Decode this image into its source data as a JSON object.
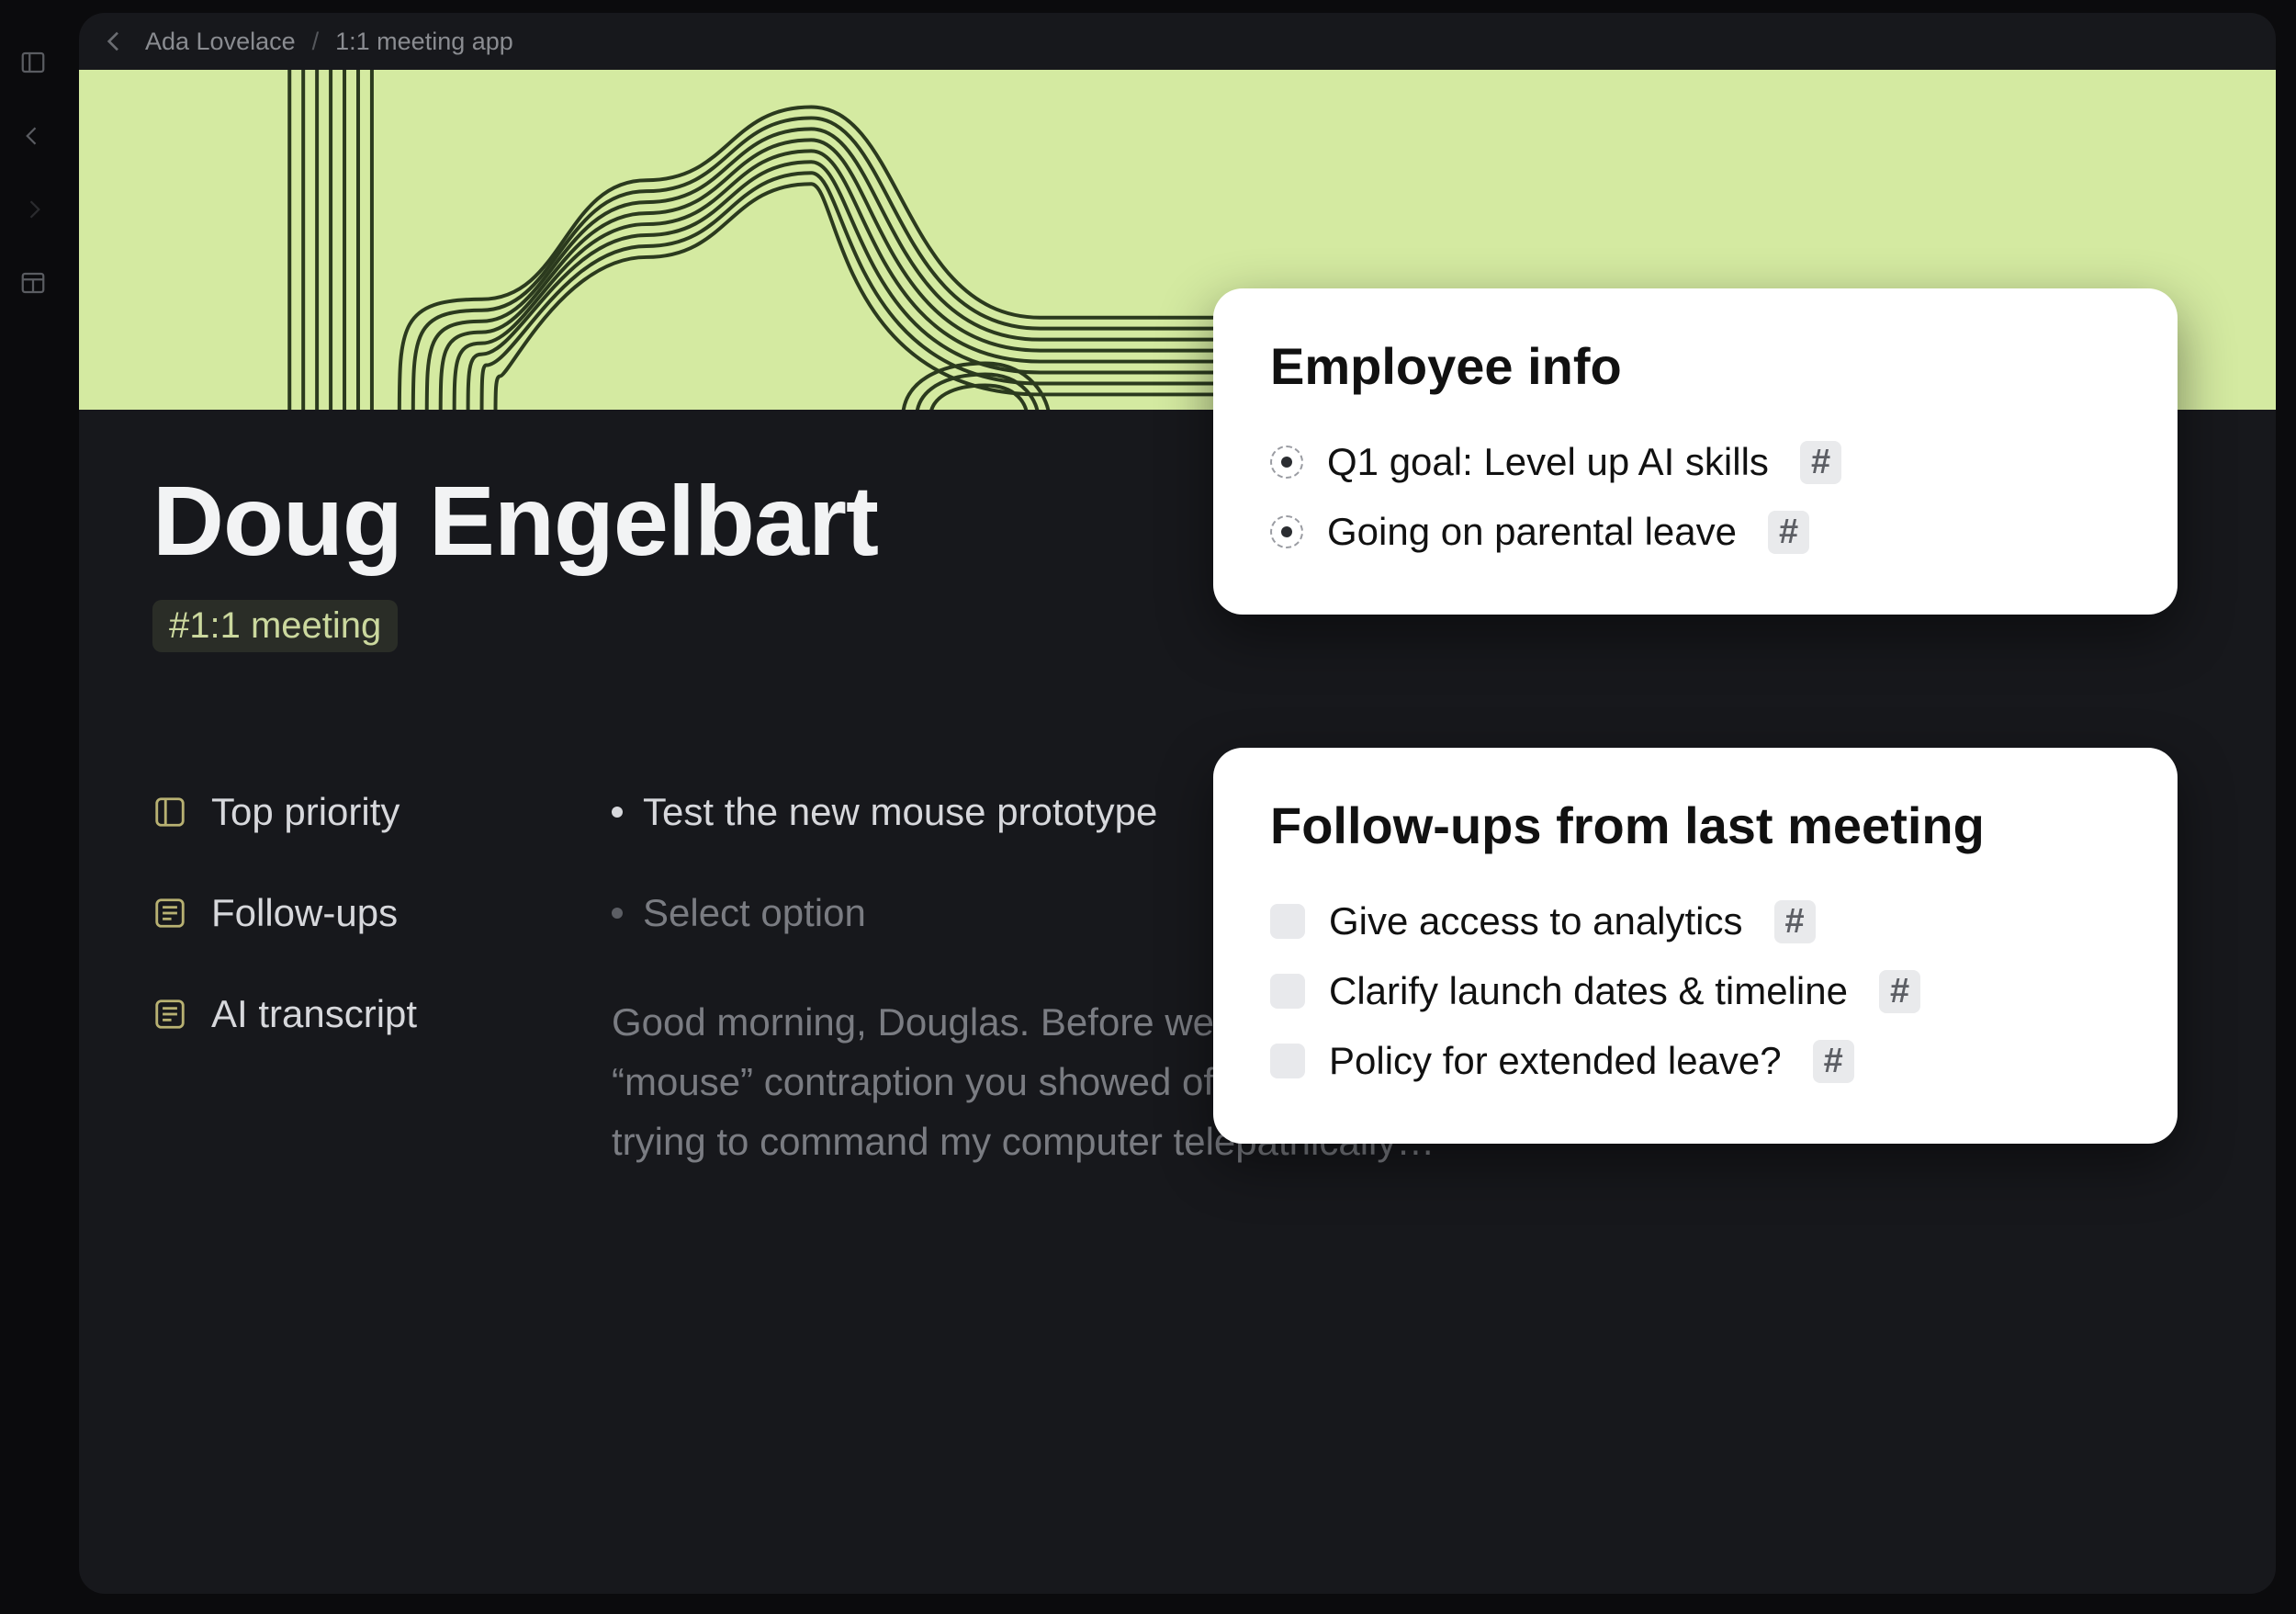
{
  "breadcrumb": {
    "parent": "Ada Lovelace",
    "current": "1:1 meeting app"
  },
  "page": {
    "title": "Doug Engelbart",
    "tag": "#1:1 meeting"
  },
  "fields": {
    "top_priority": {
      "label": "Top priority",
      "value": "Test the new mouse prototype"
    },
    "follow_ups": {
      "label": "Follow-ups",
      "placeholder": "Select option"
    },
    "ai_transcript": {
      "label": "AI transcript",
      "value": "Good morning, Douglas. Before we start—I love the new “mouse” contraption you showed off. I’ve finally stopped trying to command my computer telepathically…"
    }
  },
  "employee_info": {
    "title": "Employee info",
    "items": [
      {
        "text": "Q1 goal: Level up AI skills",
        "hash": "#"
      },
      {
        "text": "Going on parental leave",
        "hash": "#"
      }
    ]
  },
  "followups_card": {
    "title": "Follow-ups from last meeting",
    "items": [
      {
        "text": "Give access to analytics",
        "hash": "#"
      },
      {
        "text": "Clarify launch dates & timeline",
        "hash": "#"
      },
      {
        "text": "Policy for extended leave?",
        "hash": "#"
      }
    ]
  }
}
